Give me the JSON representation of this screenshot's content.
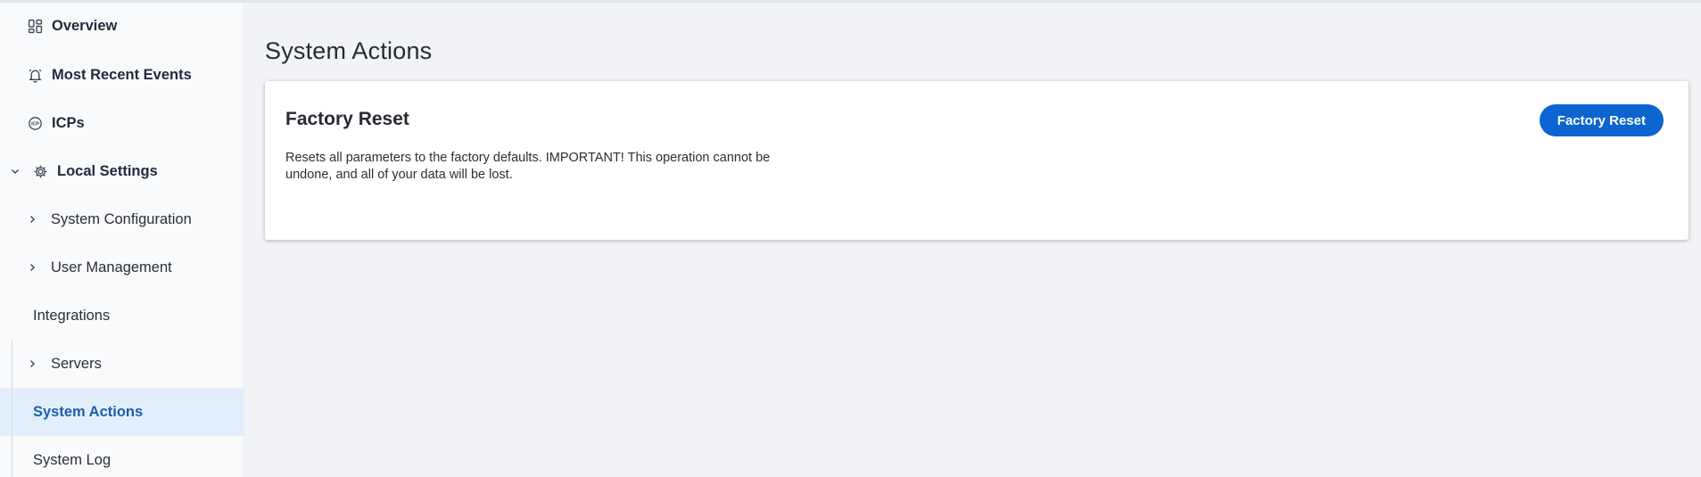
{
  "sidebar": {
    "overview": {
      "label": "Overview",
      "icon": "dashboard-icon"
    },
    "recent_events": {
      "label": "Most Recent Events",
      "icon": "bell-icon"
    },
    "icps": {
      "label": "ICPs",
      "icon": "icp-icon"
    },
    "local_settings": {
      "label": "Local Settings",
      "icon": "gear-icon",
      "expanded": true
    },
    "sub_items": {
      "system_configuration": "System Configuration",
      "user_management": "User Management",
      "integrations": "Integrations",
      "servers": "Servers",
      "system_actions": "System Actions",
      "system_log": "System Log"
    },
    "active_item": "System Actions"
  },
  "main": {
    "title": "System Actions",
    "card": {
      "title": "Factory Reset",
      "description": "Resets all parameters to the factory defaults. IMPORTANT! This operation cannot be undone, and all of your data will be lost.",
      "button_label": "Factory Reset"
    }
  },
  "colors": {
    "accent": "#0b64cf",
    "active_bg": "#e3eefb",
    "active_text": "#1b5fad",
    "page_bg": "#f1f3f6"
  }
}
